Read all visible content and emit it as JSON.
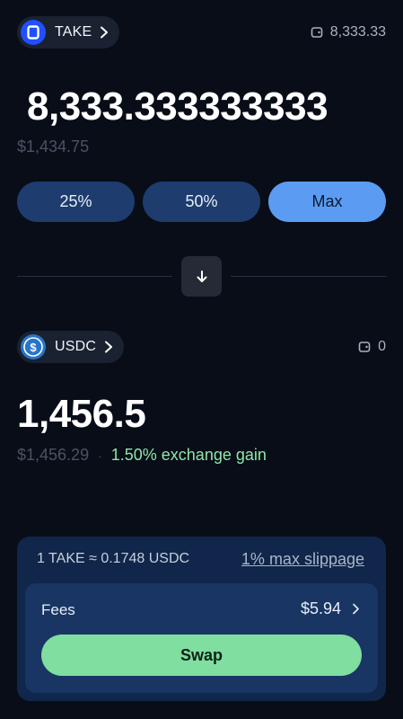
{
  "from": {
    "token": "TAKE",
    "balance": "8,333.33",
    "amount": "8,333.333333333",
    "usd_value": "$1,434.75"
  },
  "percent_buttons": [
    "25%",
    "50%",
    "Max"
  ],
  "to": {
    "token": "USDC",
    "balance": "0",
    "amount": "1,456.5",
    "usd_value": "$1,456.29",
    "separator": "·",
    "gain": "1.50% exchange gain"
  },
  "summary": {
    "rate": "1 TAKE ≈ 0.1748 USDC",
    "slippage": "1% max slippage",
    "fees_label": "Fees",
    "fees_value": "$5.94",
    "swap_label": "Swap"
  },
  "colors": {
    "background": "#080d18",
    "take_logo": "#1f4fff",
    "usdc_logo": "#2775ca",
    "max_button": "#5b9cf2",
    "swap_button": "#7fdea0",
    "gain_text": "#8ee6a6"
  },
  "icons": {
    "from_token": "take-logo-icon",
    "to_token": "usdc-logo-icon",
    "wallet": "wallet-icon",
    "chevron": "chevron-right-icon",
    "swap_direction": "arrow-down-icon"
  }
}
